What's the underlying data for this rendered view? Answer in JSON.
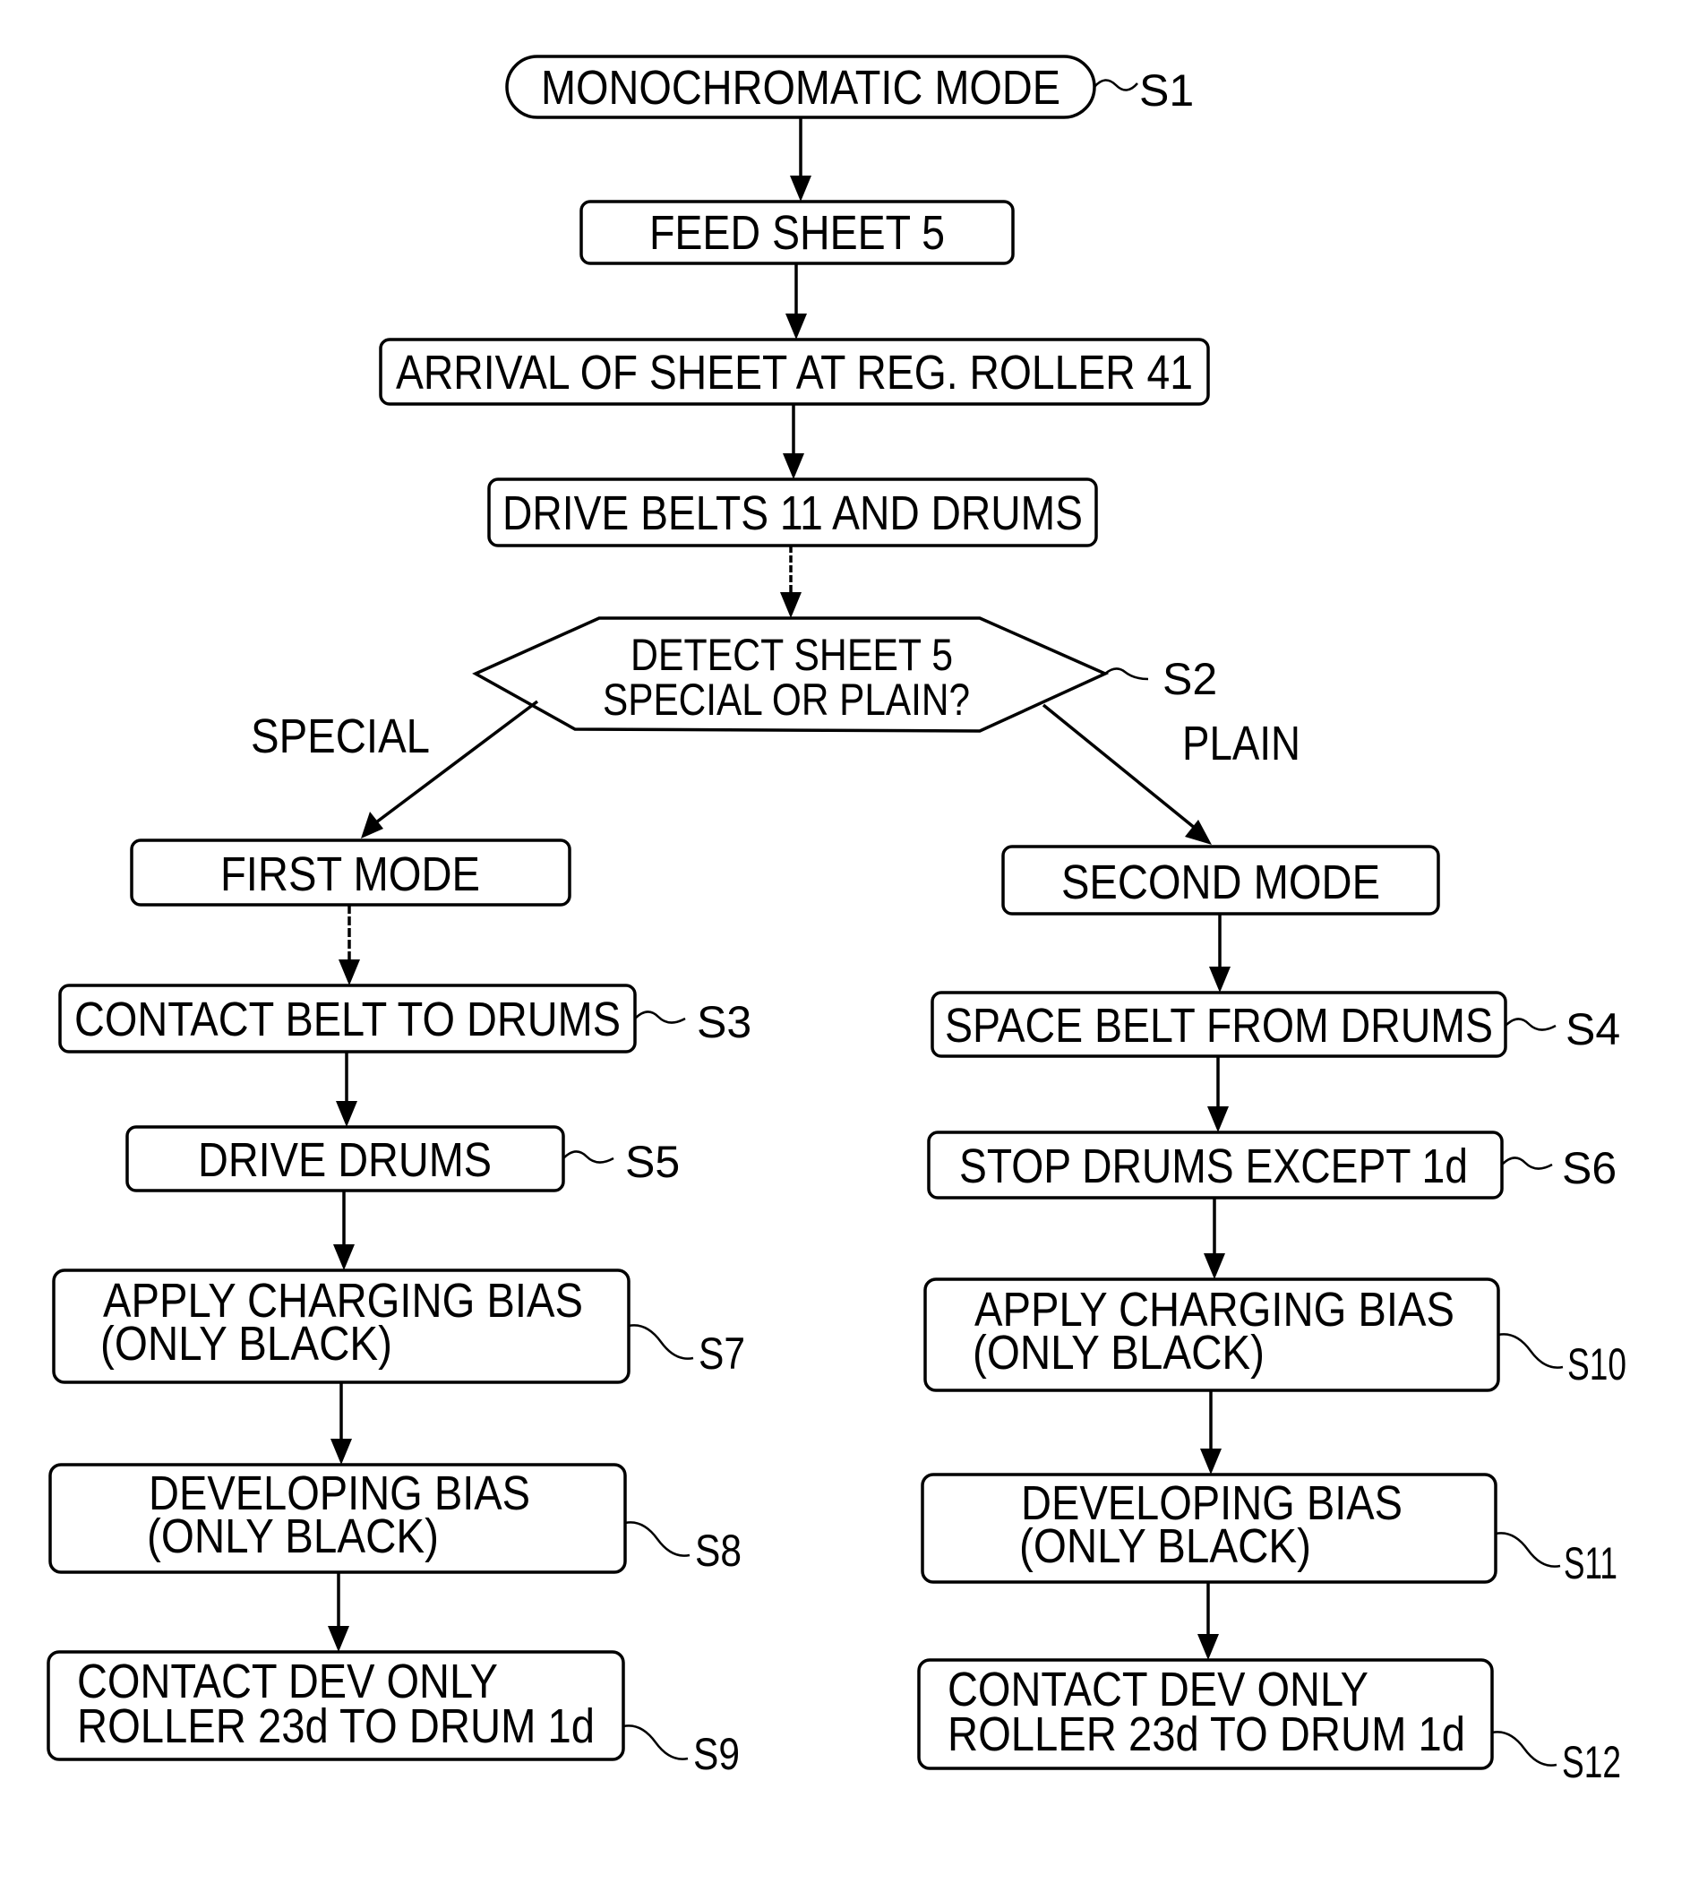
{
  "diagram": {
    "type": "flowchart",
    "start": {
      "id": "S1",
      "label": "MONOCHROMATIC MODE"
    },
    "common_steps": [
      {
        "id": "feed",
        "label": "FEED SHEET 5"
      },
      {
        "id": "arrival",
        "label": "ARRIVAL OF SHEET AT REG. ROLLER 41"
      },
      {
        "id": "drive_belts",
        "label": "DRIVE BELTS 11 AND DRUMS"
      }
    ],
    "decision": {
      "id": "S2",
      "lines": [
        "DETECT SHEET 5",
        "SPECIAL OR PLAIN?"
      ],
      "branches": {
        "left": "SPECIAL",
        "right": "PLAIN"
      }
    },
    "left_branch": {
      "mode": {
        "label": "FIRST MODE"
      },
      "steps": [
        {
          "id": "S3",
          "lines": [
            "CONTACT BELT TO DRUMS"
          ]
        },
        {
          "id": "S5",
          "lines": [
            "DRIVE DRUMS"
          ]
        },
        {
          "id": "S7",
          "lines": [
            "APPLY CHARGING BIAS",
            "(ONLY BLACK)"
          ]
        },
        {
          "id": "S8",
          "lines": [
            "DEVELOPING BIAS",
            "(ONLY BLACK)"
          ]
        },
        {
          "id": "S9",
          "lines": [
            "CONTACT DEV ONLY",
            "ROLLER 23d TO DRUM 1d"
          ]
        }
      ]
    },
    "right_branch": {
      "mode": {
        "label": "SECOND MODE"
      },
      "steps": [
        {
          "id": "S4",
          "lines": [
            "SPACE BELT FROM DRUMS"
          ]
        },
        {
          "id": "S6",
          "lines": [
            "STOP DRUMS EXCEPT 1d"
          ]
        },
        {
          "id": "S10",
          "lines": [
            "APPLY CHARGING BIAS",
            "(ONLY BLACK)"
          ]
        },
        {
          "id": "S11",
          "lines": [
            "DEVELOPING BIAS",
            "(ONLY BLACK)"
          ]
        },
        {
          "id": "S12",
          "lines": [
            "CONTACT DEV ONLY",
            "ROLLER 23d TO DRUM 1d"
          ]
        }
      ]
    }
  }
}
